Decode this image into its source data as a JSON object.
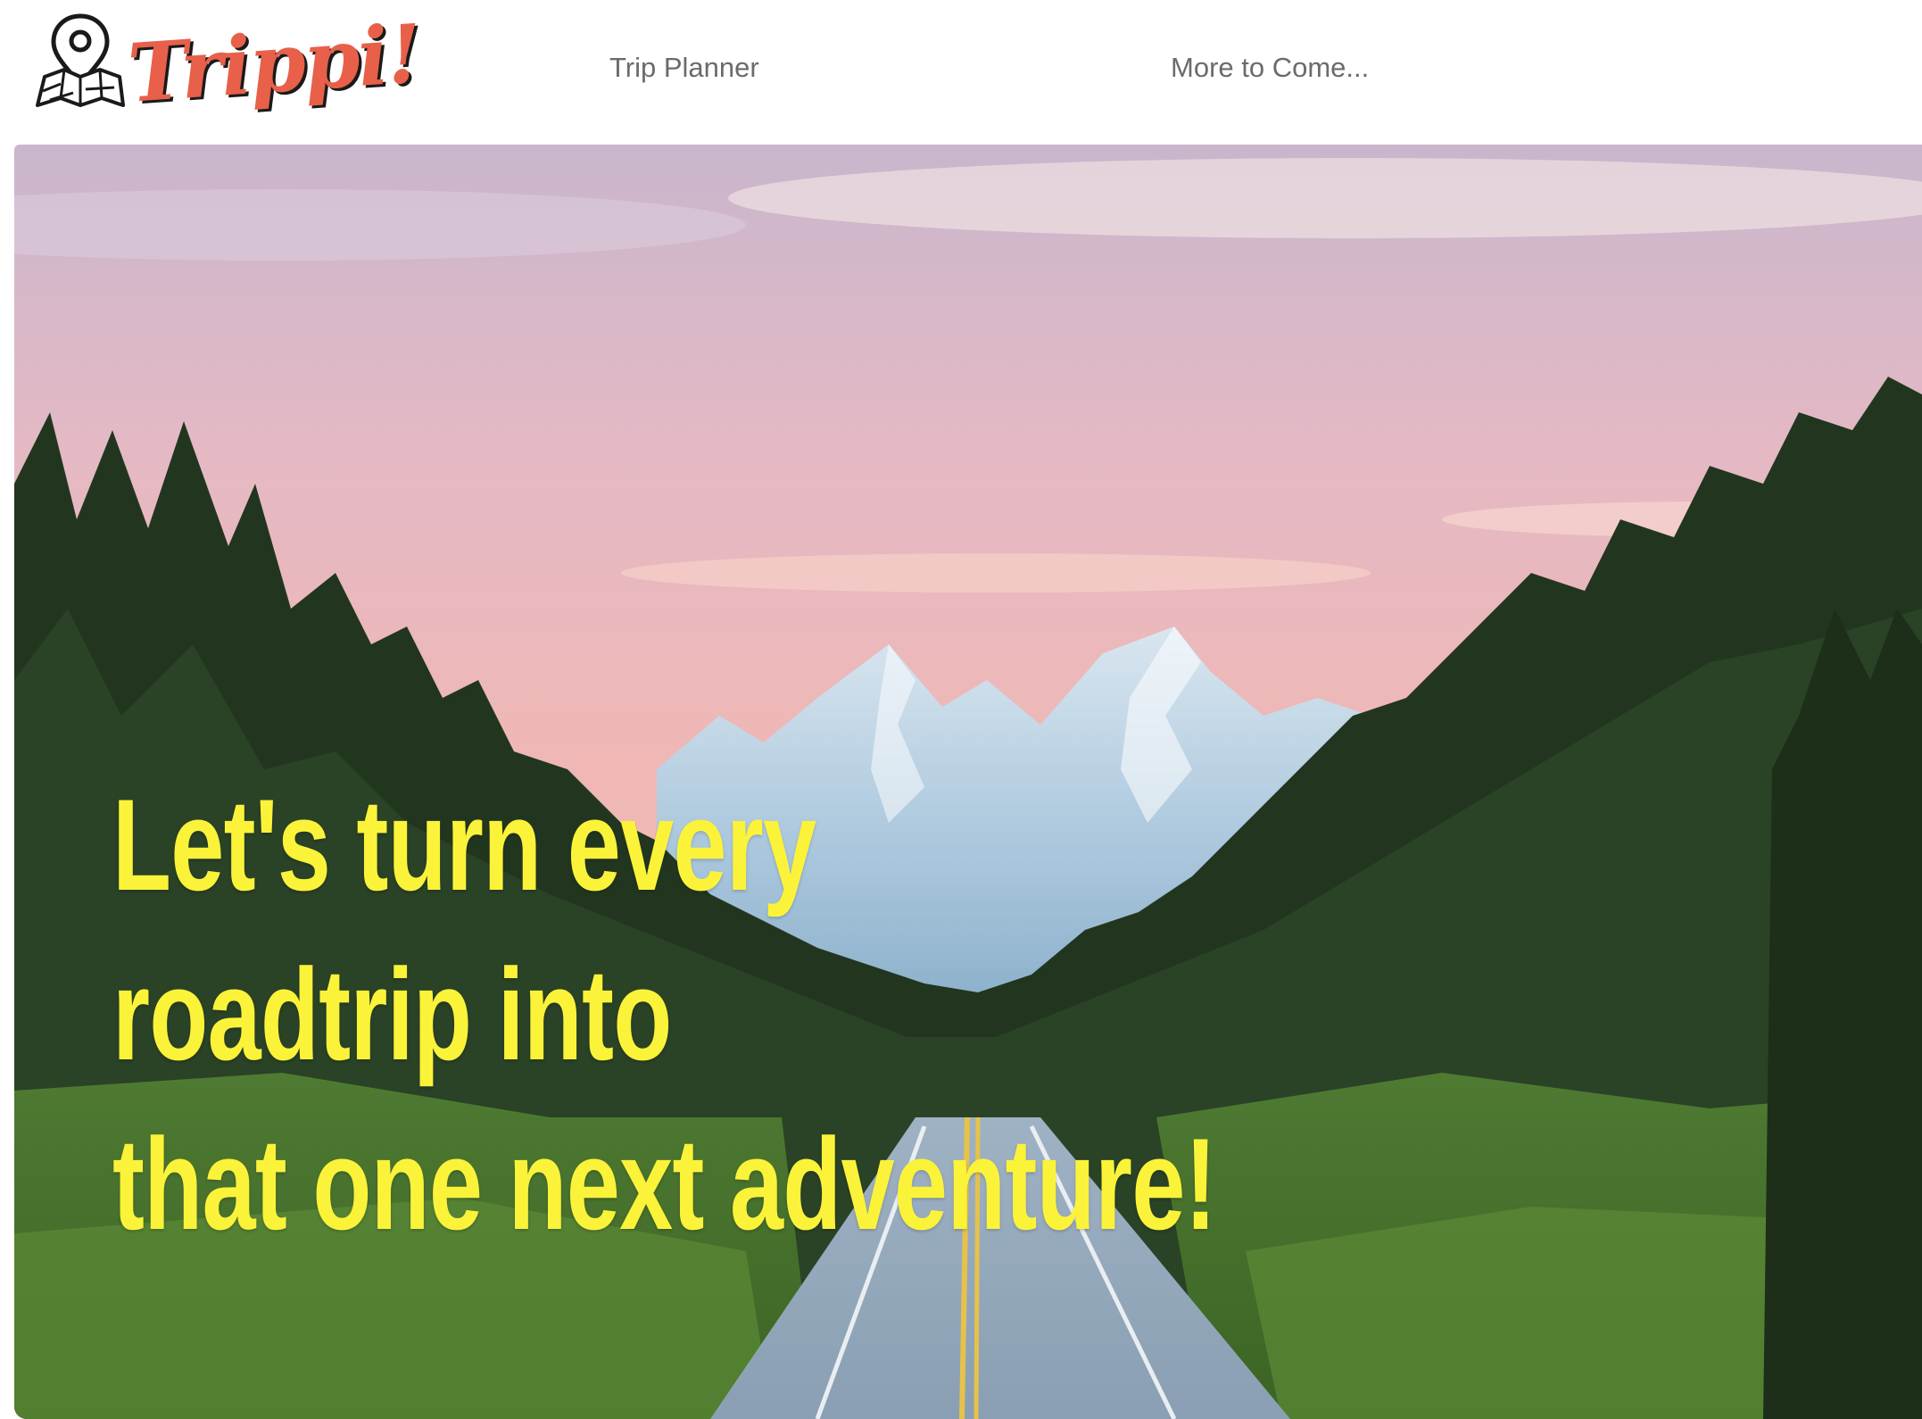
{
  "brand": {
    "name": "Trippi!",
    "logo_icon": "map-pin-map-icon",
    "color": "#e8604a"
  },
  "nav": {
    "items": [
      {
        "label": "Trip Planner"
      },
      {
        "label": "More to Come..."
      }
    ]
  },
  "hero": {
    "headline_lines": [
      "Let's turn every",
      "roadtrip into",
      "that one next adventure!"
    ],
    "headline_color": "#fbf33a",
    "image": "mountain-road-forest-sunset-photo"
  }
}
